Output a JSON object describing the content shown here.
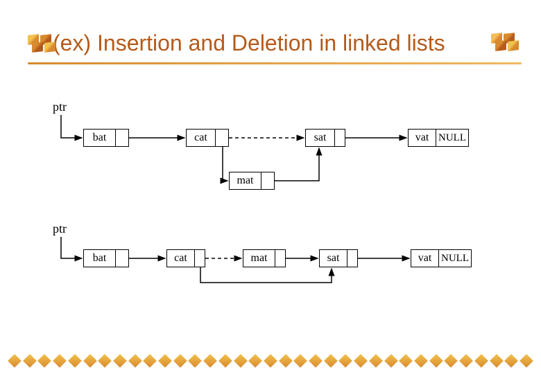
{
  "title": "(ex) Insertion and Deletion in linked lists",
  "diagram1": {
    "ptr_label": "ptr",
    "nodes": {
      "n1": {
        "data": "bat"
      },
      "n2": {
        "data": "cat"
      },
      "n3": {
        "data": "sat"
      },
      "n4": {
        "data": "vat",
        "next": "NULL"
      },
      "ins": {
        "data": "mat"
      }
    }
  },
  "diagram2": {
    "ptr_label": "ptr",
    "nodes": {
      "n1": {
        "data": "bat"
      },
      "n2": {
        "data": "cat"
      },
      "n3": {
        "data": "mat"
      },
      "n4": {
        "data": "sat"
      },
      "n5": {
        "data": "vat",
        "next": "NULL"
      }
    }
  },
  "colors": {
    "title": "#b55a1a",
    "accent": "#d88a2e"
  }
}
